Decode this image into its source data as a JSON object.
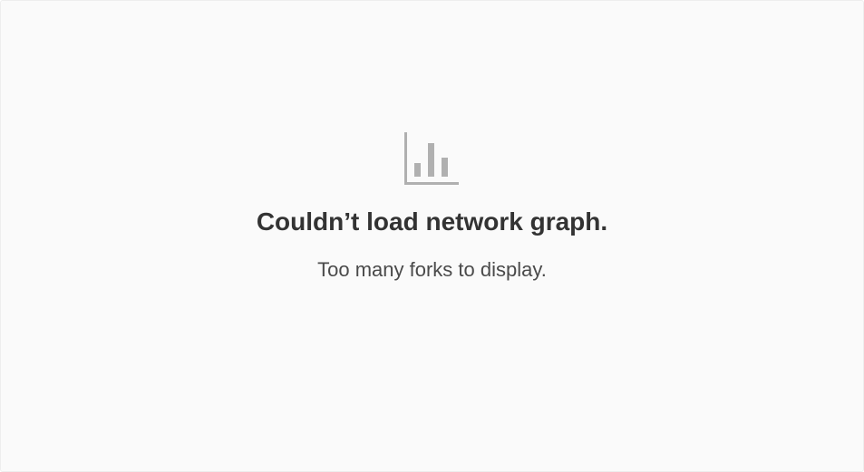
{
  "blankslate": {
    "icon": "graph-icon",
    "icon_color": "#b0b0b0",
    "title": "Couldn’t load network graph.",
    "message": "Too many forks to display."
  }
}
